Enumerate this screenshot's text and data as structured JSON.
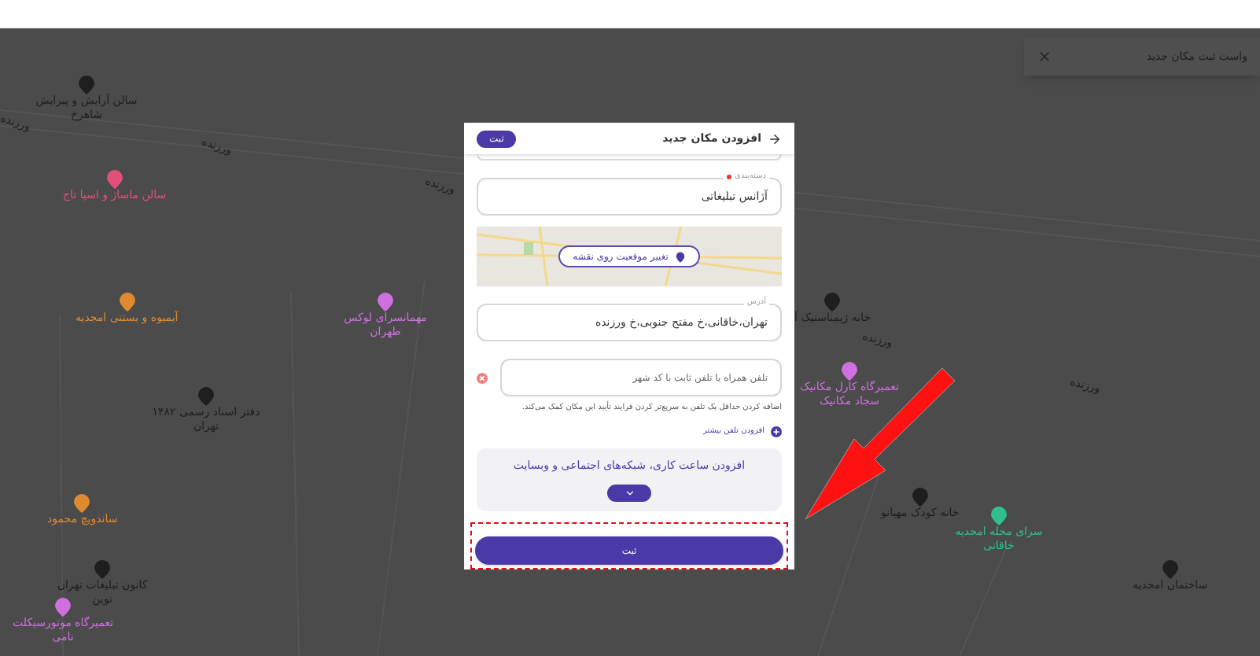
{
  "notification": {
    "text": "واست ثبت مکان جدید"
  },
  "map_labels": [
    {
      "kind": "poi",
      "text": "سالن آرایش و پیرایش شاهرخ",
      "color": "#1e1e1e"
    },
    {
      "kind": "road",
      "text": "ورزنده"
    },
    {
      "kind": "road",
      "text": "ورزنده"
    },
    {
      "kind": "poi",
      "text": "سالن ماساژ و اسپا تاج",
      "color": "#e0507a"
    },
    {
      "kind": "road",
      "text": "ورزنده"
    },
    {
      "kind": "poi",
      "text": "خانه ژیمناستیک آ",
      "color": "#1e1e1e"
    },
    {
      "kind": "poi",
      "text": "مهمانسرای لوکس طهران",
      "color": "#d070e0"
    },
    {
      "kind": "poi",
      "text": "آبمیوه و بستنی امجدیه",
      "color": "#e08a30"
    },
    {
      "kind": "road",
      "text": "ورزنده"
    },
    {
      "kind": "road",
      "text": "ورزنده"
    },
    {
      "kind": "poi",
      "text": "دفتر اسناد رسمی ۱۴۸۲ تهران",
      "color": "#1e1e1e"
    },
    {
      "kind": "poi",
      "text": "تعمیرگاه کارل مکانیک سجاد مکانیک",
      "color": "#d070e0"
    },
    {
      "kind": "poi",
      "text": "خانه کودک مهیانو",
      "color": "#1e1e1e"
    },
    {
      "kind": "poi",
      "text": "ساندویچ محمود",
      "color": "#e08a30"
    },
    {
      "kind": "poi",
      "text": "سرای محله امجدیه خاقانی",
      "color": "#30c090"
    },
    {
      "kind": "poi",
      "text": "ساختمان امجدیه",
      "color": "#1e1e1e"
    },
    {
      "kind": "poi",
      "text": "کانون تبلیغات تهران نوین",
      "color": "#1e1e1e"
    },
    {
      "kind": "poi",
      "text": "تعمیرگاه موتورسیکلت نامی",
      "color": "#d070e0"
    }
  ],
  "dialog": {
    "title": "افزودن مکان جدید",
    "header_button": "ثبت",
    "category": {
      "label": "دسته‌بندی",
      "required": true,
      "value": "آژانس تبلیغاتی"
    },
    "map_button": "تغییر موقعیت روی نقشه",
    "address": {
      "label": "آدرس",
      "value": "تهران،خاقانی،خ مفتح جنوبی،خ ورزنده"
    },
    "phone": {
      "placeholder": "تلفن همراه یا تلفن ثابت با کد شهر"
    },
    "hint": "اضافه کردن حداقل یک تلفن به سریع‌تر کردن فرایند تأیید این مکان کمک می‌کند.",
    "add_phone": "افزودن تلفن بیشتر",
    "more_section": {
      "title": "افزودن ساعت کاری، شبکه‌های اجتماعی و وبسایت",
      "expanded": false
    },
    "submit": "ثبت"
  }
}
